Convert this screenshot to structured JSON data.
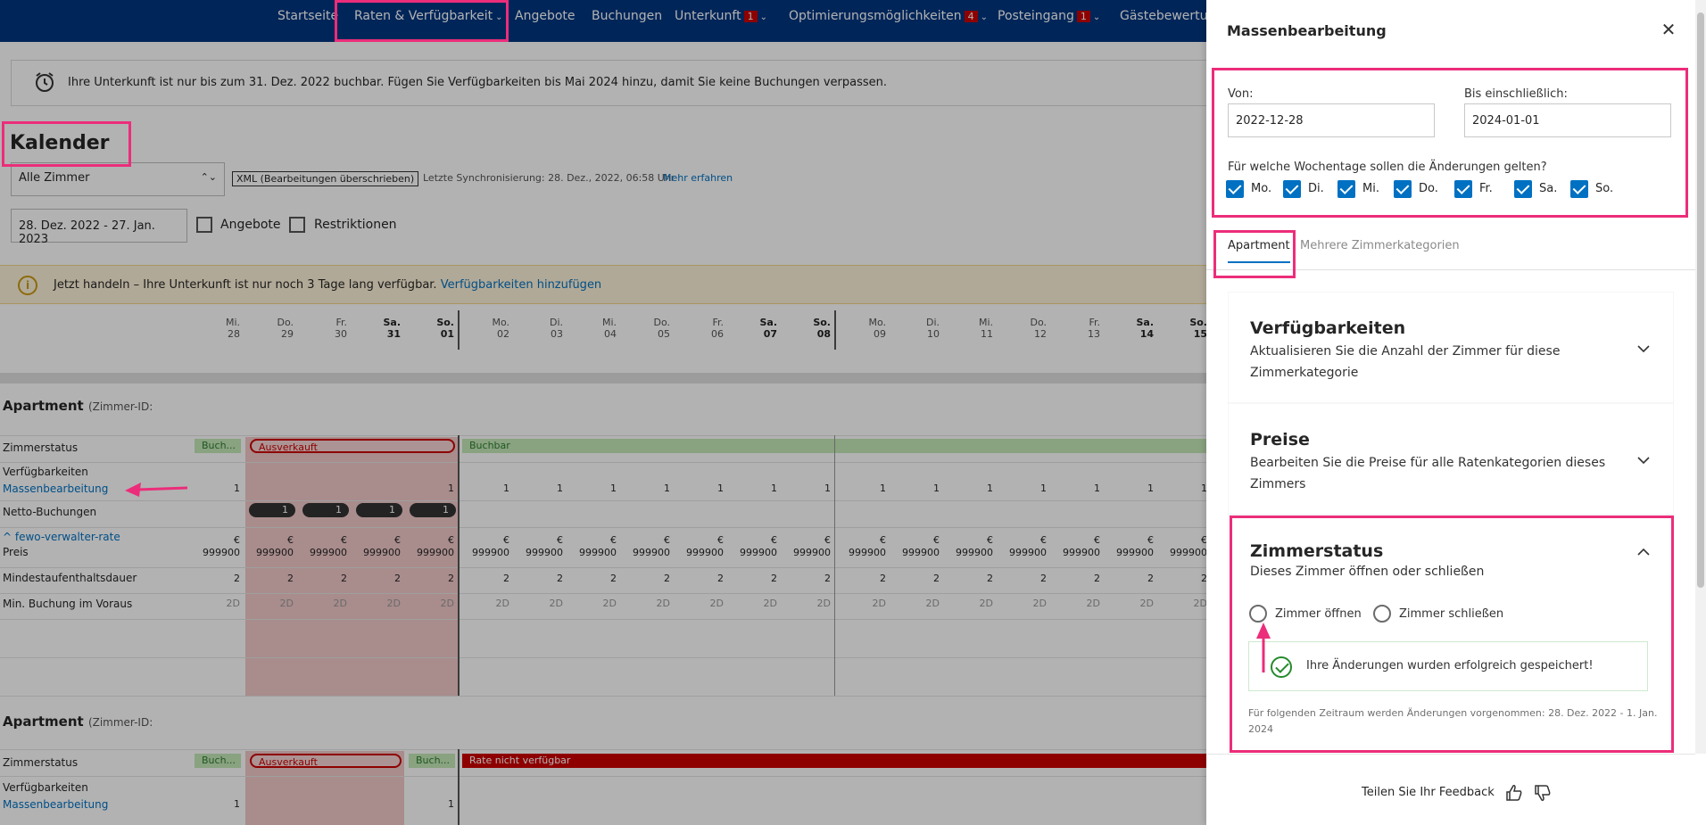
{
  "nav": {
    "items": [
      {
        "label": "Startseite",
        "chev": false,
        "badge": ""
      },
      {
        "label": "Raten & Verfügbarkeit",
        "chev": true,
        "badge": ""
      },
      {
        "label": "Angebote",
        "chev": false,
        "badge": ""
      },
      {
        "label": "Buchungen",
        "chev": false,
        "badge": ""
      },
      {
        "label": "Unterkunft",
        "chev": true,
        "badge": "1"
      },
      {
        "label": "Optimierungsmöglichkeiten",
        "chev": true,
        "badge": "4"
      },
      {
        "label": "Posteingang",
        "chev": true,
        "badge": "1"
      },
      {
        "label": "Gästebewertun",
        "chev": false,
        "badge": ""
      }
    ]
  },
  "notice": {
    "text": "Ihre Unterkunft ist nur bis zum 31. Dez. 2022 buchbar. Fügen Sie Verfügbarkeiten bis Mai 2024 hinzu, damit Sie keine Buchungen verpassen."
  },
  "calendar": {
    "title": "Kalender",
    "room_select": "Alle Zimmer",
    "xml_tag": "XML (Bearbeitungen überschrieben)",
    "sync_text": "Letzte Synchronisierung: 28. Dez., 2022, 06:58 Uhr",
    "sync_link": "Mehr erfahren",
    "date_range": "28. Dez. 2022 - 27. Jan. 2023",
    "filter_offers": "Angebote",
    "filter_restrictions": "Restriktionen",
    "warning_text": "Jetzt handeln – Ihre Unterkunft ist nur noch 3 Tage lang verfügbar.",
    "warning_link": "Verfügbarkeiten hinzufügen",
    "days": [
      {
        "wd": "Mi.",
        "d": "28",
        "bold": false
      },
      {
        "wd": "Do.",
        "d": "29",
        "bold": false
      },
      {
        "wd": "Fr.",
        "d": "30",
        "bold": false
      },
      {
        "wd": "Sa.",
        "d": "31",
        "bold": true
      },
      {
        "wd": "So.",
        "d": "01",
        "bold": true
      },
      {
        "wd": "Mo.",
        "d": "02",
        "bold": false
      },
      {
        "wd": "Di.",
        "d": "03",
        "bold": false
      },
      {
        "wd": "Mi.",
        "d": "04",
        "bold": false
      },
      {
        "wd": "Do.",
        "d": "05",
        "bold": false
      },
      {
        "wd": "Fr.",
        "d": "06",
        "bold": false
      },
      {
        "wd": "Sa.",
        "d": "07",
        "bold": true
      },
      {
        "wd": "So.",
        "d": "08",
        "bold": true
      },
      {
        "wd": "Mo.",
        "d": "09",
        "bold": false
      },
      {
        "wd": "Di.",
        "d": "10",
        "bold": false
      },
      {
        "wd": "Mi.",
        "d": "11",
        "bold": false
      },
      {
        "wd": "Do.",
        "d": "12",
        "bold": false
      },
      {
        "wd": "Fr.",
        "d": "13",
        "bold": false
      },
      {
        "wd": "Sa.",
        "d": "14",
        "bold": true
      },
      {
        "wd": "So.",
        "d": "15",
        "bold": true
      }
    ],
    "section1": {
      "room": "Apartment",
      "room_id_label": "(Zimmer-ID:",
      "status_label": "Zimmerstatus",
      "status_buch": "Buch...",
      "status_sold": "Ausverkauft",
      "status_bookable": "Buchbar",
      "avail_label": "Verfügbarkeiten",
      "mass_edit_link": "Massenbearbeitung",
      "net_label": "Netto-Buchungen",
      "rate_name": "fewo-verwalter-rate",
      "price_label": "Preis",
      "minstay_label": "Mindestaufenthaltsdauer",
      "advance_label": "Min. Buchung im Voraus",
      "avail_value": "1",
      "net_value": "1",
      "currency": "€",
      "price_value": "999900",
      "minstay_value": "2",
      "advance_value": "2D"
    },
    "section2": {
      "room": "Apartment",
      "room_id_label": "(Zimmer-ID:",
      "status_label": "Zimmerstatus",
      "status_buch": "Buch...",
      "status_sold": "Ausverkauft",
      "status_buch2": "Buch...",
      "status_unavailable": "Rate nicht verfügbar",
      "avail_label": "Verfügbarkeiten",
      "mass_edit_link": "Massenbearbeitung",
      "avail_value": "1"
    }
  },
  "drawer": {
    "title": "Massenbearbeitung",
    "from_label": "Von:",
    "from_value": "2022-12-28",
    "to_label": "Bis einschließlich:",
    "to_value": "2024-01-01",
    "weekdays_question": "Für welche Wochentage sollen die Änderungen gelten?",
    "weekdays": [
      "Mo.",
      "Di.",
      "Mi.",
      "Do.",
      "Fr.",
      "Sa.",
      "So."
    ],
    "tabs": [
      {
        "label": "Apartment",
        "active": true
      },
      {
        "label": "Mehrere Zimmerkategorien",
        "active": false
      }
    ],
    "sections": {
      "availability": {
        "title": "Verfügbarkeiten",
        "desc": "Aktualisieren Sie die Anzahl der Zimmer für diese Zimmerkategorie"
      },
      "prices": {
        "title": "Preise",
        "desc": "Bearbeiten Sie die Preise für alle Ratenkategorien dieses Zimmers"
      },
      "room_status": {
        "title": "Zimmerstatus",
        "desc": "Dieses Zimmer öffnen oder schließen",
        "open_label": "Zimmer öffnen",
        "close_label": "Zimmer schließen",
        "success_msg": "Ihre Änderungen wurden erfolgreich gespeichert!",
        "period_note": "Für folgenden Zeitraum werden Änderungen vorgenommen: 28. Dez. 2022 - 1. Jan. 2024"
      }
    },
    "feedback_label": "Teilen Sie Ihr Feedback"
  },
  "colors": {
    "nav_bg": "#003580",
    "accent_blue": "#0071c2",
    "highlight_pink": "#ec2d7a",
    "success_green": "#258a2c",
    "sold_out_red": "#cc0000"
  }
}
